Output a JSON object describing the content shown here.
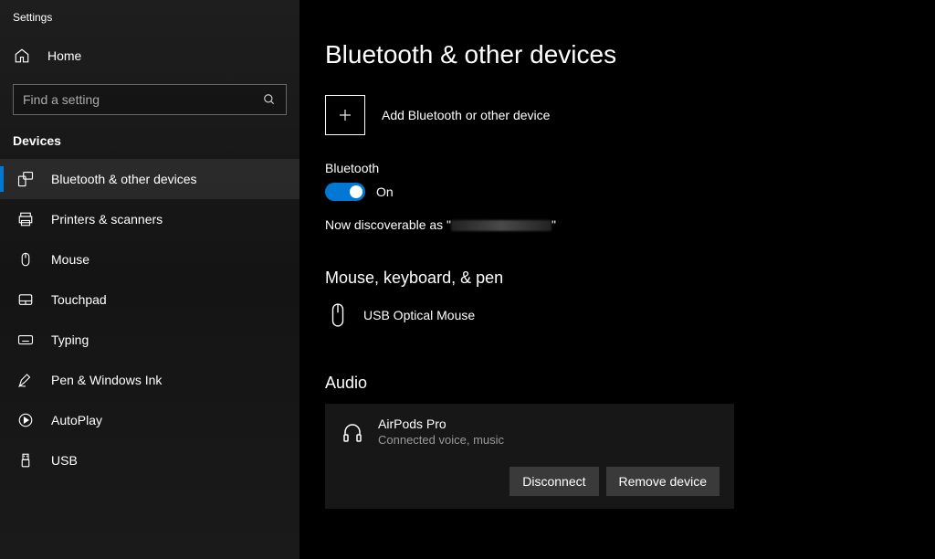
{
  "app_title": "Settings",
  "home_label": "Home",
  "search": {
    "placeholder": "Find a setting"
  },
  "category": "Devices",
  "nav": [
    {
      "label": "Bluetooth & other devices",
      "selected": true
    },
    {
      "label": "Printers & scanners",
      "selected": false
    },
    {
      "label": "Mouse",
      "selected": false
    },
    {
      "label": "Touchpad",
      "selected": false
    },
    {
      "label": "Typing",
      "selected": false
    },
    {
      "label": "Pen & Windows Ink",
      "selected": false
    },
    {
      "label": "AutoPlay",
      "selected": false
    },
    {
      "label": "USB",
      "selected": false
    }
  ],
  "page": {
    "title": "Bluetooth & other devices",
    "add_label": "Add Bluetooth or other device",
    "bt_label": "Bluetooth",
    "toggle_status": "On",
    "discoverable_prefix": "Now discoverable as \"",
    "discoverable_suffix": "\""
  },
  "sections": {
    "mouse_header": "Mouse, keyboard, & pen",
    "mouse_device": "USB Optical Mouse",
    "audio_header": "Audio",
    "audio_device": "AirPods Pro",
    "audio_status": "Connected voice, music",
    "disconnect": "Disconnect",
    "remove": "Remove device"
  },
  "colors": {
    "accent": "#0078d4",
    "annotation": "#ed1c24"
  }
}
